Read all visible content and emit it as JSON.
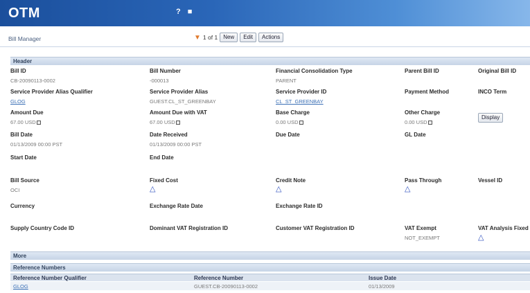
{
  "app": {
    "logo": "OTM",
    "top_icons": [
      "?",
      "■"
    ]
  },
  "toolbar": {
    "page_title": "Bill Manager",
    "record_count": "1 of 1",
    "new_label": "New",
    "edit_label": "Edit",
    "actions_label": "Actions"
  },
  "header_section": {
    "title": "Header",
    "bill_id": {
      "label": "Bill ID",
      "value": "CB-20090113-0002"
    },
    "bill_number": {
      "label": "Bill Number",
      "value": "-000013"
    },
    "financial_consolidation_type": {
      "label": "Financial Consolidation Type",
      "value": "PARENT"
    },
    "parent_bill_id": {
      "label": "Parent Bill ID"
    },
    "original_bill_id": {
      "label": "Original Bill ID"
    },
    "sp_alias_qualifier": {
      "label": "Service Provider Alias Qualifier",
      "value": "GLOG"
    },
    "sp_alias": {
      "label": "Service Provider Alias",
      "value": "GUEST.CL_ST_GREENBAY"
    },
    "sp_id": {
      "label": "Service Provider ID",
      "value": "CL_ST_GREENBAY"
    },
    "payment_method": {
      "label": "Payment Method"
    },
    "incoterm": {
      "label": "INCO Term"
    },
    "amount_due": {
      "label": "Amount Due",
      "value": "67.00 USD"
    },
    "amount_due_vat": {
      "label": "Amount Due with VAT",
      "value": "67.00 USD"
    },
    "base_charge": {
      "label": "Base Charge",
      "value": "0.00 USD"
    },
    "other_charge": {
      "label": "Other Charge",
      "value": "0.00 USD"
    },
    "display_label": "Display",
    "bill_date": {
      "label": "Bill Date",
      "value": "01/13/2009 00:00 PST"
    },
    "date_received": {
      "label": "Date Received",
      "value": "01/13/2009 00:00 PST"
    },
    "due_date": {
      "label": "Due Date"
    },
    "gl_date": {
      "label": "GL Date"
    },
    "start_date": {
      "label": "Start Date"
    },
    "end_date": {
      "label": "End Date"
    },
    "bill_source": {
      "label": "Bill Source",
      "value": "OCI"
    },
    "fixed_cost": {
      "label": "Fixed Cost"
    },
    "credit_note": {
      "label": "Credit Note"
    },
    "pass_through": {
      "label": "Pass Through"
    },
    "vessel_id": {
      "label": "Vessel ID"
    },
    "currency": {
      "label": "Currency"
    },
    "exchange_rate_date": {
      "label": "Exchange Rate Date"
    },
    "exchange_rate_id": {
      "label": "Exchange Rate ID"
    },
    "supply_country": {
      "label": "Supply Country Code ID"
    },
    "dominant_vat_reg": {
      "label": "Dominant VAT Registration ID"
    },
    "customer_vat_reg": {
      "label": "Customer VAT Registration ID"
    },
    "vat_exempt": {
      "label": "VAT Exempt",
      "value": "NOT_EXEMPT"
    },
    "vat_analysis": {
      "label": "VAT Analysis Fixed"
    }
  },
  "more_section": {
    "title": "More"
  },
  "reference_numbers": {
    "title": "Reference Numbers",
    "columns": [
      "Reference Number Qualifier",
      "Reference Number",
      "Issue Date"
    ],
    "rows": [
      [
        "GLOG",
        "GUEST.CB-20090113-0002",
        "01/13/2009"
      ]
    ]
  },
  "colors": {
    "topbar": "#2a66b8",
    "link": "#3a6fb5",
    "section": "#c6d4e6",
    "icon_triangle": "#2e4fbf"
  }
}
